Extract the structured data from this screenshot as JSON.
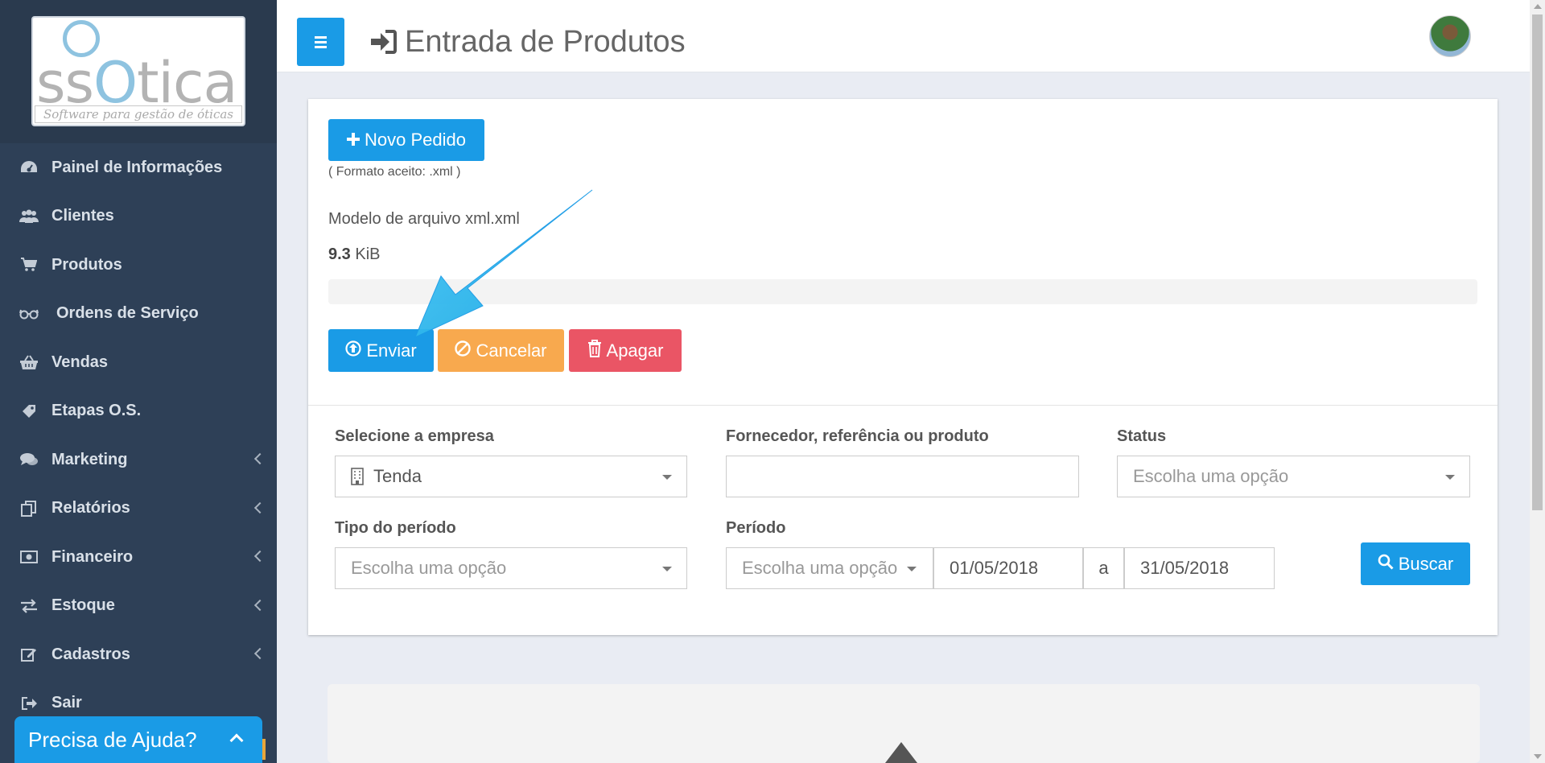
{
  "app": {
    "logo_text": "ssOtica",
    "logo_tagline": "Software para gestão de óticas",
    "page_title": "Entrada de Produtos"
  },
  "sidebar": {
    "items": [
      {
        "label": "Painel de Informações",
        "icon": "dashboard-icon",
        "has_submenu": false
      },
      {
        "label": "Clientes",
        "icon": "users-icon",
        "has_submenu": false
      },
      {
        "label": "Produtos",
        "icon": "cart-icon",
        "has_submenu": false
      },
      {
        "label": "Ordens de Serviço",
        "icon": "glasses-icon",
        "has_submenu": false
      },
      {
        "label": "Vendas",
        "icon": "basket-icon",
        "has_submenu": false
      },
      {
        "label": "Etapas O.S.",
        "icon": "tag-icon",
        "has_submenu": false
      },
      {
        "label": "Marketing",
        "icon": "comments-icon",
        "has_submenu": true
      },
      {
        "label": "Relatórios",
        "icon": "copy-icon",
        "has_submenu": true
      },
      {
        "label": "Financeiro",
        "icon": "money-icon",
        "has_submenu": true
      },
      {
        "label": "Estoque",
        "icon": "exchange-icon",
        "has_submenu": true
      },
      {
        "label": "Cadastros",
        "icon": "edit-icon",
        "has_submenu": true
      },
      {
        "label": "Sair",
        "icon": "sign-out-icon",
        "has_submenu": false
      }
    ],
    "help_label": "Precisa de Ajuda?"
  },
  "upload": {
    "new_order_label": "Novo Pedido",
    "format_note": "( Formato aceito: .xml )",
    "file_name": "Modelo de arquivo xml.xml",
    "file_size_value": "9.3",
    "file_size_unit": "KiB",
    "progress": 0,
    "send_label": "Enviar",
    "cancel_label": "Cancelar",
    "delete_label": "Apagar"
  },
  "filters": {
    "company_label": "Selecione a empresa",
    "company_value": "Tenda",
    "supplier_label": "Fornecedor, referência ou produto",
    "supplier_value": "",
    "status_label": "Status",
    "status_placeholder": "Escolha uma opção",
    "period_type_label": "Tipo do período",
    "period_type_placeholder": "Escolha uma opção",
    "period_label": "Período",
    "period_placeholder": "Escolha uma opção",
    "date_from": "01/05/2018",
    "date_sep": "a",
    "date_to": "31/05/2018",
    "search_label": "Buscar"
  },
  "colors": {
    "primary": "#1a9be6",
    "warning": "#f8a94e",
    "danger": "#ea5565",
    "sidebar": "#2e4057",
    "annotation_arrow": "#29b6ef"
  }
}
